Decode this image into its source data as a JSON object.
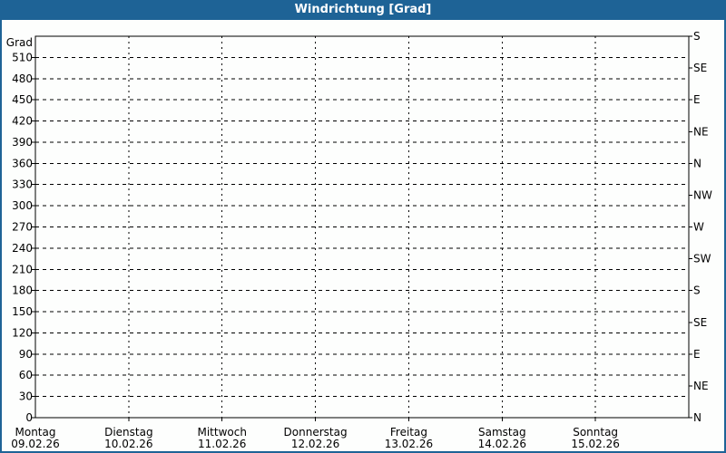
{
  "window": {
    "title": "Windrichtung [Grad]"
  },
  "colors": {
    "frame_blue": "#1e6396",
    "title_text": "#ffffff",
    "axis_black": "#000000",
    "plot_background": "#fdfefd"
  },
  "chart_data": {
    "type": "line",
    "title": "Windrichtung [Grad]",
    "ylabel": "Grad",
    "ylim": [
      0,
      540
    ],
    "y_axis": {
      "unit_label": "Grad",
      "min": 0,
      "max": 540,
      "tick_step": 30,
      "tick_labels": [
        "0",
        "30",
        "60",
        "90",
        "120",
        "150",
        "180",
        "210",
        "240",
        "270",
        "300",
        "330",
        "360",
        "390",
        "420",
        "450",
        "480",
        "510"
      ]
    },
    "right_axis": {
      "ticks": [
        {
          "value": 540,
          "label": "S"
        },
        {
          "value": 495,
          "label": "SE"
        },
        {
          "value": 450,
          "label": "E"
        },
        {
          "value": 405,
          "label": "NE"
        },
        {
          "value": 360,
          "label": "N"
        },
        {
          "value": 315,
          "label": "NW"
        },
        {
          "value": 270,
          "label": "W"
        },
        {
          "value": 225,
          "label": "SW"
        },
        {
          "value": 180,
          "label": "S"
        },
        {
          "value": 135,
          "label": "SE"
        },
        {
          "value": 90,
          "label": "E"
        },
        {
          "value": 45,
          "label": "NE"
        },
        {
          "value": 0,
          "label": "N"
        }
      ]
    },
    "x_axis": {
      "days": [
        {
          "name": "Montag",
          "date": "09.02.26"
        },
        {
          "name": "Dienstag",
          "date": "10.02.26"
        },
        {
          "name": "Mittwoch",
          "date": "11.02.26"
        },
        {
          "name": "Donnerstag",
          "date": "12.02.26"
        },
        {
          "name": "Freitag",
          "date": "13.02.26"
        },
        {
          "name": "Samstag",
          "date": "14.02.26"
        },
        {
          "name": "Sonntag",
          "date": "15.02.26"
        }
      ]
    },
    "series": [],
    "grid": {
      "horizontal": "dashed",
      "vertical": "dashed"
    },
    "legend": "none"
  }
}
